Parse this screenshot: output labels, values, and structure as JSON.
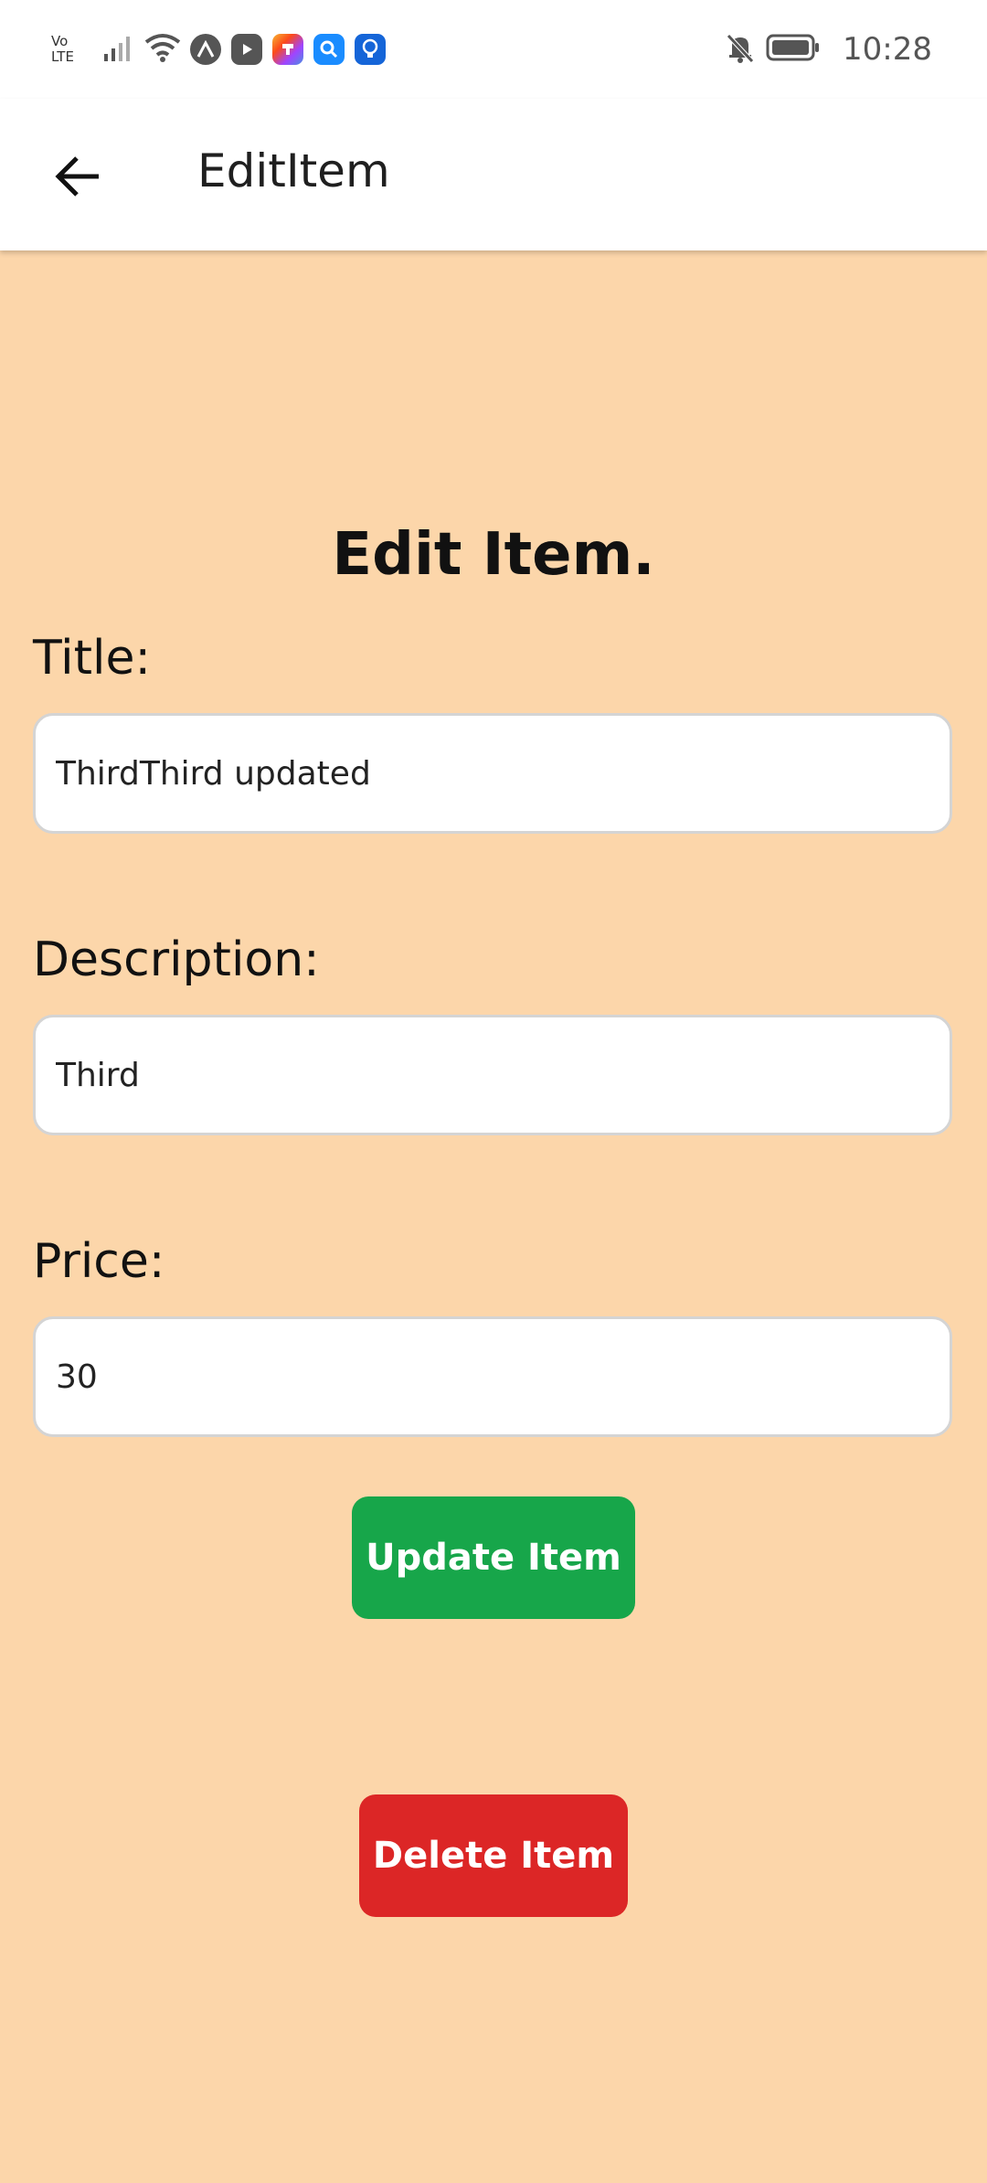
{
  "status_bar": {
    "network_label": "Vo\nLTE",
    "time": "10:28",
    "icons": [
      "volte-icon",
      "signal-icon",
      "wifi-icon",
      "app-expo-icon",
      "youtube-icon",
      "app-colorful-icon",
      "search-app-icon",
      "bulb-app-icon",
      "bell-off-icon",
      "battery-icon"
    ]
  },
  "app_bar": {
    "title": "EditItem",
    "back_icon": "arrow-left-icon"
  },
  "page": {
    "heading": "Edit Item.",
    "title_label": "Title:",
    "title_value": "ThirdThird updated",
    "description_label": "Description:",
    "description_value": "Third",
    "price_label": "Price:",
    "price_value": "30",
    "update_button": "Update Item",
    "delete_button": "Delete Item"
  },
  "colors": {
    "background": "#fcd6aa",
    "update_button": "#17a64a",
    "delete_button": "#dc2626",
    "app_bar": "#ffffff"
  }
}
